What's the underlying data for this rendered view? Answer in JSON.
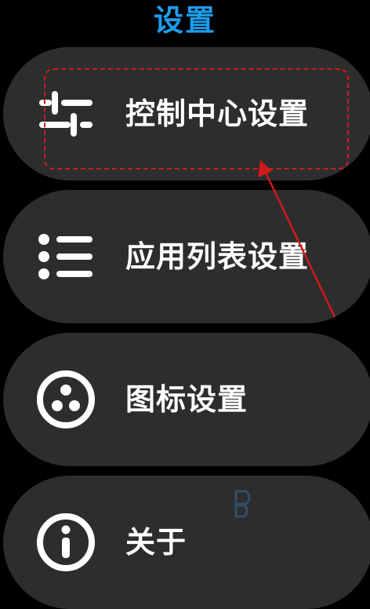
{
  "colors": {
    "title": "#1e9bea",
    "card_bg": "#2d2d2d",
    "icon": "#ffffff",
    "annotation": "#d11a1a"
  },
  "header": {
    "title": "设置"
  },
  "menu": {
    "items": [
      {
        "label": "控制中心设置",
        "icon": "sliders-icon"
      },
      {
        "label": "应用列表设置",
        "icon": "list-icon"
      },
      {
        "label": "图标设置",
        "icon": "icon-style-icon"
      },
      {
        "label": "关于",
        "icon": "info-icon"
      }
    ]
  }
}
